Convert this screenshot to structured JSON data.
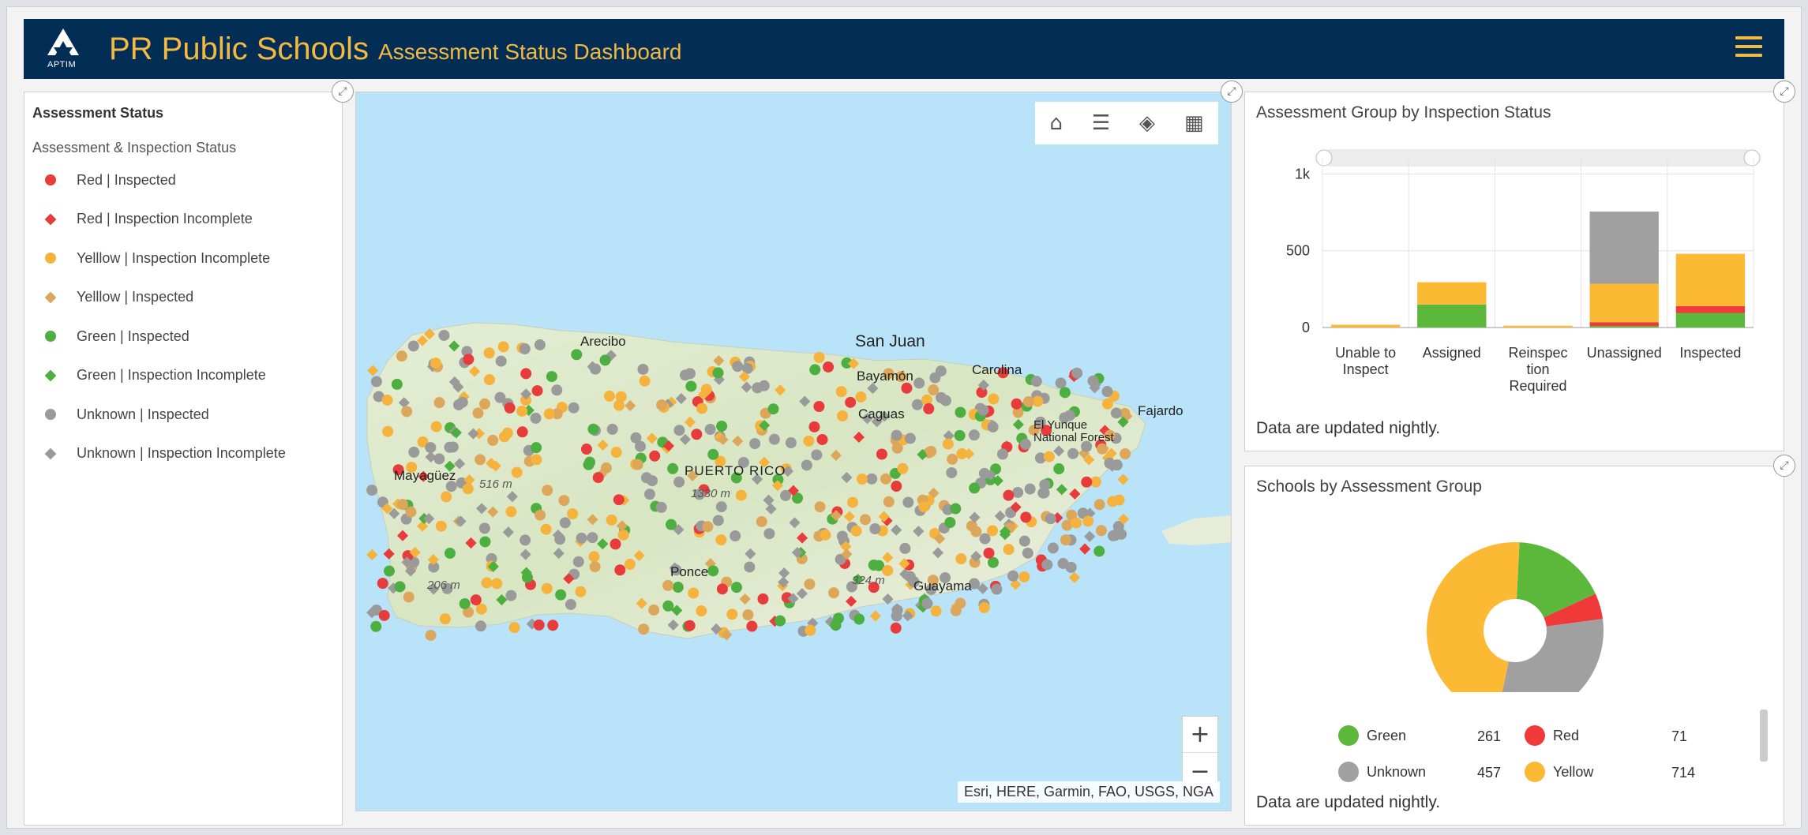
{
  "header": {
    "logo_text": "APTIM",
    "title": "PR Public Schools",
    "subtitle": "Assessment Status Dashboard",
    "accent_color": "#f4b942",
    "bg_color": "#022e55",
    "menu_icon": "hamburger-icon"
  },
  "legend": {
    "title": "Assessment Status",
    "subtitle": "Assessment & Inspection Status",
    "items": [
      {
        "label": "Red | Inspected",
        "shape": "circle",
        "color": "#e83b3b"
      },
      {
        "label": "Red | Inspection Incomplete",
        "shape": "diamond",
        "color": "#e83b3b"
      },
      {
        "label": "Yelllow | Inspection Incomplete",
        "shape": "circle",
        "color": "#f5b23c"
      },
      {
        "label": "Yelllow | Inspected",
        "shape": "diamond",
        "color": "#dca75a"
      },
      {
        "label": "Green | Inspected",
        "shape": "circle",
        "color": "#4caf3f"
      },
      {
        "label": "Green | Inspection Incomplete",
        "shape": "diamond",
        "color": "#4caf3f"
      },
      {
        "label": "Unknown | Inspected",
        "shape": "circle",
        "color": "#9a9a9a"
      },
      {
        "label": "Unknown | Inspection Incomplete",
        "shape": "diamond",
        "color": "#9a9a9a"
      }
    ]
  },
  "map": {
    "tools": [
      "home-icon",
      "legend-list-icon",
      "layers-icon",
      "basemap-gallery-icon"
    ],
    "zoom_in": "+",
    "zoom_out": "−",
    "attribution": "Esri, HERE, Garmin, FAO, USGS, NGA",
    "labels": {
      "san_juan": "San Juan",
      "arecibo": "Arecibo",
      "carolina": "Carolina",
      "bayamon": "Bayamón",
      "caguas": "Caguas",
      "fajardo": "Fajardo",
      "el_yunque": "El Yunque National Forest",
      "mayaguez": "Mayagüez",
      "puerto_rico": "PUERTO RICO",
      "ponce": "Ponce",
      "guayama": "Guayama",
      "elev_516": "516 m",
      "elev_1330": "1330 m",
      "elev_324": "324 m",
      "elev_206": "206 m"
    }
  },
  "bar_panel": {
    "title": "Assessment Group by Inspection Status",
    "note": "Data are updated nightly."
  },
  "pie_panel": {
    "title": "Schools by Assessment Group",
    "note": "Data are updated nightly.",
    "legend": [
      {
        "name": "Green",
        "value": "261",
        "color": "#5bb83a"
      },
      {
        "name": "Red",
        "value": "71",
        "color": "#f03a3a"
      },
      {
        "name": "Unknown",
        "value": "457",
        "color": "#a0a0a0"
      },
      {
        "name": "Yellow",
        "value": "714",
        "color": "#fbb934"
      }
    ]
  },
  "chart_data": [
    {
      "type": "bar",
      "stacked": true,
      "title": "Assessment Group by Inspection Status",
      "categories": [
        "Unable to Inspect",
        "Assigned",
        "Reinspection Required",
        "Unassigned",
        "Inspected"
      ],
      "category_labels": [
        [
          "Unable to",
          "Inspect"
        ],
        [
          "Assigned"
        ],
        [
          "Reinspec",
          "tion",
          "Required"
        ],
        [
          "Unassigned"
        ],
        [
          "Inspected"
        ]
      ],
      "series": [
        {
          "values": [
            0,
            150,
            0,
            10,
            95
          ],
          "color": "#5bb83a"
        },
        {
          "values": [
            0,
            0,
            0,
            25,
            45
          ],
          "color": "#f03a3a"
        },
        {
          "values": [
            18,
            145,
            12,
            250,
            340
          ],
          "color": "#fbb934"
        },
        {
          "values": [
            0,
            0,
            0,
            470,
            0
          ],
          "color": "#a0a0a0"
        }
      ],
      "yticks": [
        0,
        500,
        1000
      ],
      "ytick_labels": [
        "0",
        "500",
        "1k"
      ],
      "ylim": [
        0,
        1100
      ]
    },
    {
      "type": "pie",
      "title": "Schools by Assessment Group",
      "slices": [
        {
          "name": "Green",
          "value": 261,
          "color": "#5bb83a"
        },
        {
          "name": "Red",
          "value": 71,
          "color": "#f03a3a"
        },
        {
          "name": "Unknown",
          "value": 457,
          "color": "#a0a0a0"
        },
        {
          "name": "Yellow",
          "value": 714,
          "color": "#fbb934"
        }
      ]
    }
  ]
}
